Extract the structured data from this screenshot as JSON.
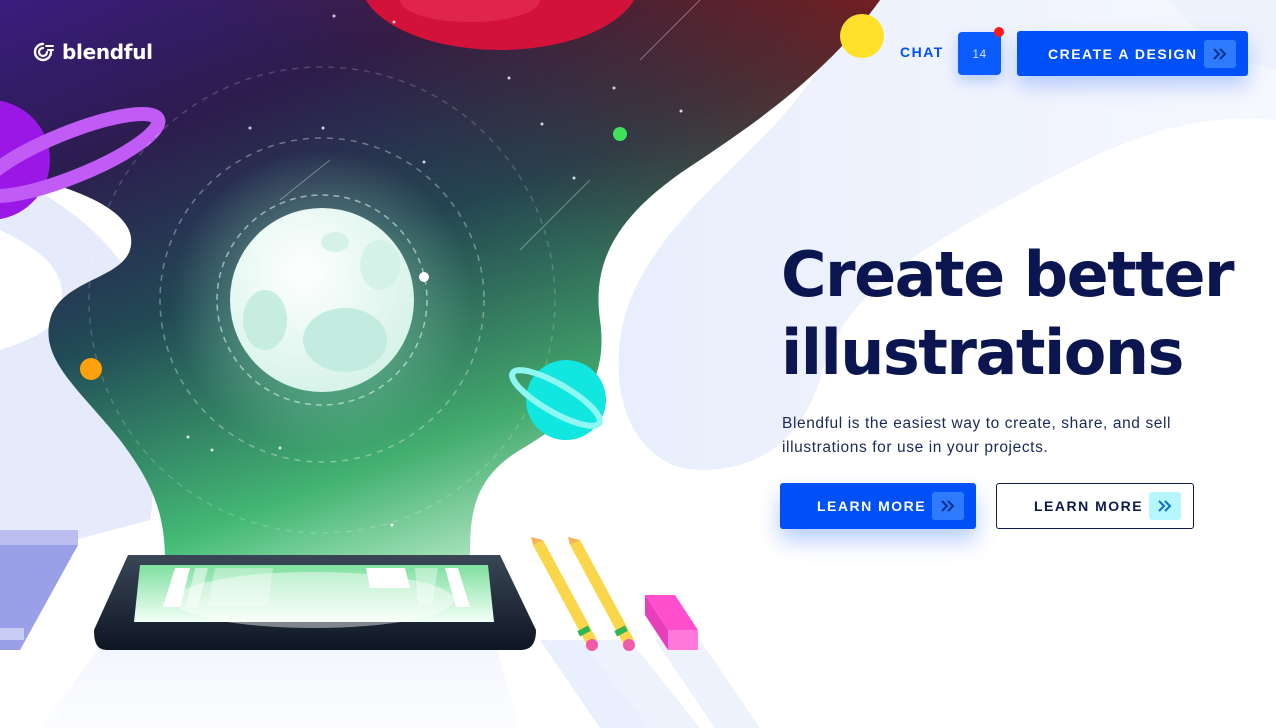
{
  "brand": {
    "name": "blendful",
    "logo_icon": "blendful-logo-icon"
  },
  "nav": {
    "chat_label": "CHAT",
    "chat_count": "14",
    "create_label": "CREATE A DESIGN",
    "create_icon": "chevron-double-right-icon"
  },
  "hero": {
    "headline_line1": "Create better",
    "headline_line2": "illustrations",
    "subtext": "Blendful is the easiest way to create, share, and sell illustrations for use in your projects.",
    "primary_button_label": "LEARN MORE",
    "secondary_button_label": "LEARN MORE",
    "button_icon": "chevron-double-right-icon"
  },
  "colors": {
    "accent": "#0050f8",
    "heading": "#0b1650",
    "notification": "#ff1a1a",
    "secondary_chevron_bg": "#b6f6ff"
  }
}
